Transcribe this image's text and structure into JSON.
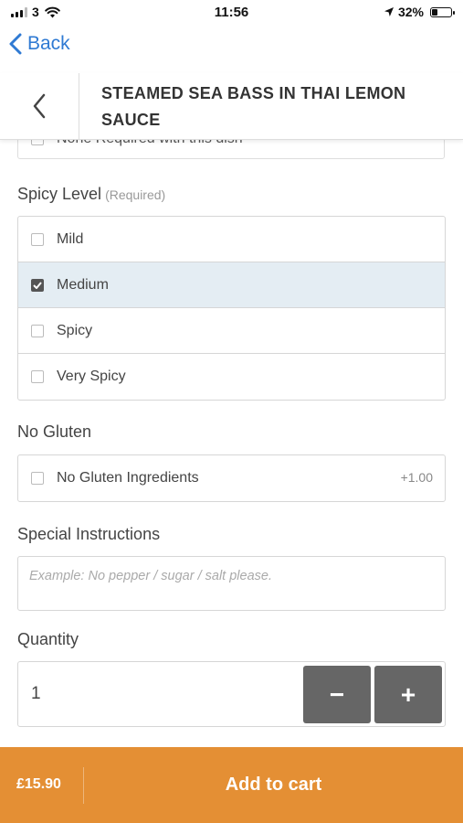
{
  "status_bar": {
    "carrier": "3",
    "time": "11:56",
    "battery_percent": "32%",
    "battery_level": 0.32,
    "icons": [
      "signal-icon",
      "wifi-icon",
      "location-icon",
      "battery-icon"
    ]
  },
  "nav": {
    "back_label": "Back"
  },
  "header": {
    "title": "STEAMED SEA BASS IN THAI LEMON SAUCE"
  },
  "previous_option": {
    "label": "None Required with this dish"
  },
  "spicy": {
    "title": "Spicy Level",
    "required": "(Required)",
    "options": [
      {
        "label": "Mild",
        "checked": false
      },
      {
        "label": "Medium",
        "checked": true
      },
      {
        "label": "Spicy",
        "checked": false
      },
      {
        "label": "Very Spicy",
        "checked": false
      }
    ]
  },
  "gluten": {
    "title": "No Gluten",
    "option_label": "No Gluten Ingredients",
    "option_price": "+1.00"
  },
  "instructions": {
    "title": "Special Instructions",
    "placeholder": "Example: No pepper / sugar / salt please."
  },
  "quantity": {
    "title": "Quantity",
    "value": "1",
    "minus": "−",
    "plus": "+"
  },
  "cart": {
    "price": "£15.90",
    "button_label": "Add to cart"
  },
  "colors": {
    "accent": "#e48f34",
    "link": "#2f7ad3",
    "selected_row": "#e4edf3",
    "stepper": "#666666"
  }
}
